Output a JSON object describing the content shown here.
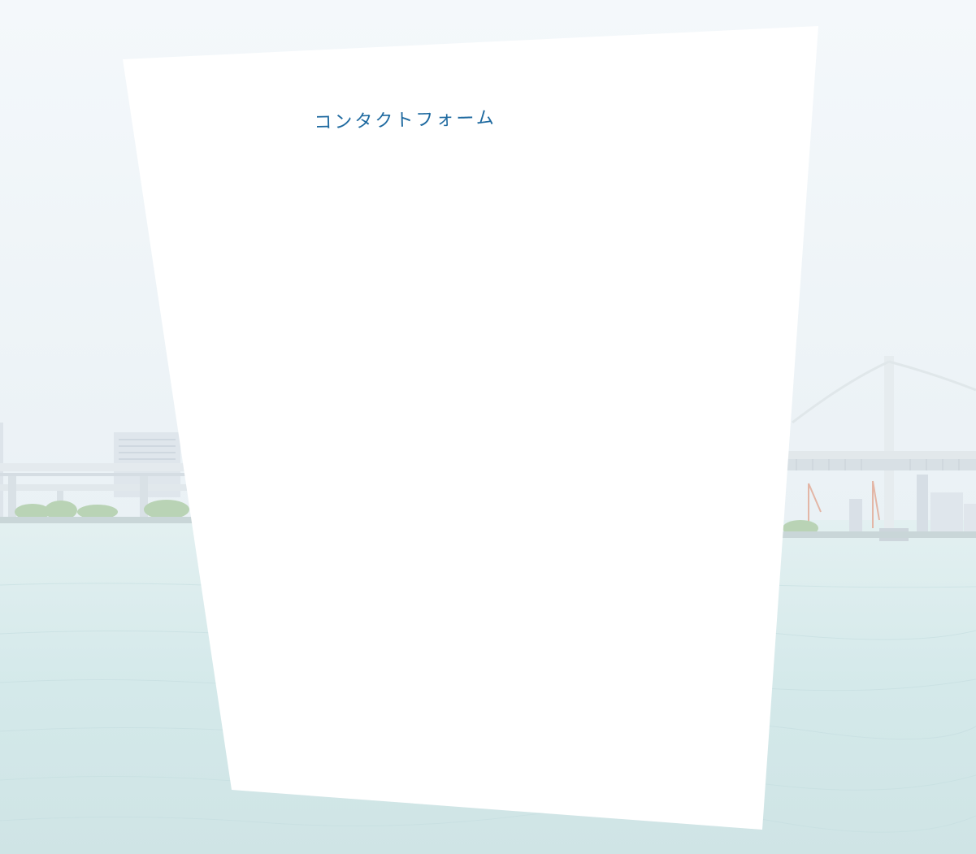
{
  "page": {
    "title": "コンタクトフォーム"
  },
  "colors": {
    "sky": "#eef4f8",
    "water": "#d8ecee",
    "bridge": "#e8eef0",
    "panel": "#ffffff",
    "title": "#1f6aa0"
  }
}
